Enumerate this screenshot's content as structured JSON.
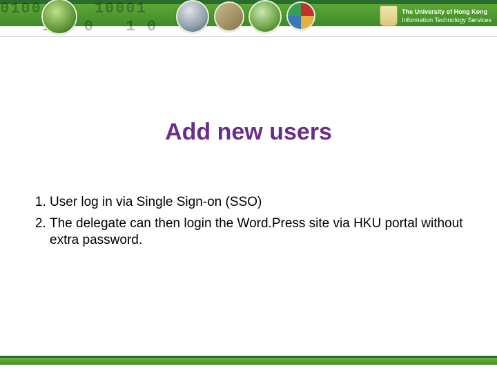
{
  "header": {
    "binary_backdrop": "0100     10001\n    10  0   1 0",
    "org_line1": "The University of Hong Kong",
    "org_line2": "Information Technology Services"
  },
  "slide": {
    "title": "Add new users"
  },
  "body": {
    "items": [
      "User log in via Single Sign-on (SSO)",
      "The delegate can then login the Word.Press site via HKU portal without extra password."
    ]
  }
}
